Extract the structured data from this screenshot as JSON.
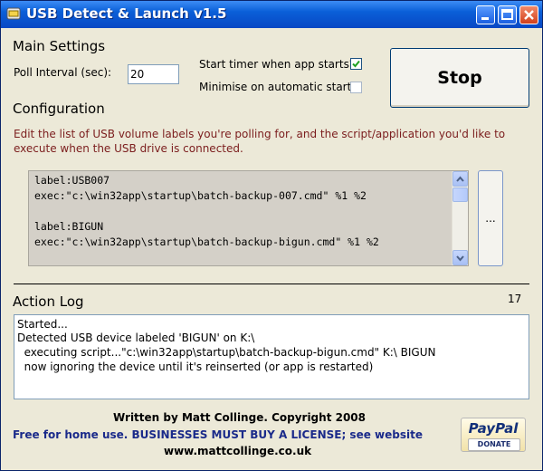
{
  "window": {
    "title": "USB Detect & Launch v1.5",
    "controls": {
      "minimize": "minimize-icon",
      "maximize": "maximize-icon",
      "close": "close-icon"
    }
  },
  "main_settings": {
    "heading": "Main Settings",
    "poll_label": "Poll Interval (sec):",
    "poll_value": "20",
    "timer_label": "Start timer when app starts?",
    "timer_checked": true,
    "minimise_label": "Minimise on automatic start?",
    "minimise_checked": false,
    "stop_button": "Stop"
  },
  "configuration": {
    "heading": "Configuration",
    "description": "Edit the list of USB volume labels you're polling for, and the script/application you'd like to execute when the USB drive is connected.",
    "text": "label:USB007\nexec:\"c:\\win32app\\startup\\batch-backup-007.cmd\" %1 %2\n\nlabel:BIGUN\nexec:\"c:\\win32app\\startup\\batch-backup-bigun.cmd\" %1 %2",
    "browse_button": "..."
  },
  "action_log": {
    "heading": "Action Log",
    "count": "17",
    "lines": [
      "Started...",
      "Detected USB device labeled 'BIGUN' on K:\\",
      "  executing script...\"c:\\win32app\\startup\\batch-backup-bigun.cmd\" K:\\ BIGUN",
      "  now ignoring the device until it's reinserted (or app is restarted)"
    ]
  },
  "footer": {
    "credit": "Written by Matt Collinge. Copyright 2008",
    "license": "Free for home use. BUSINESSES MUST BUY A LICENSE; see website",
    "website": "www.mattcollinge.co.uk",
    "paypal_logo": "PayPal",
    "paypal_button": "DONATE"
  },
  "colors": {
    "titlebar": "#0a5fd8",
    "window_bg": "#ece9d8",
    "description_text": "#7b1d1d",
    "license_text": "#1a2a8a"
  }
}
